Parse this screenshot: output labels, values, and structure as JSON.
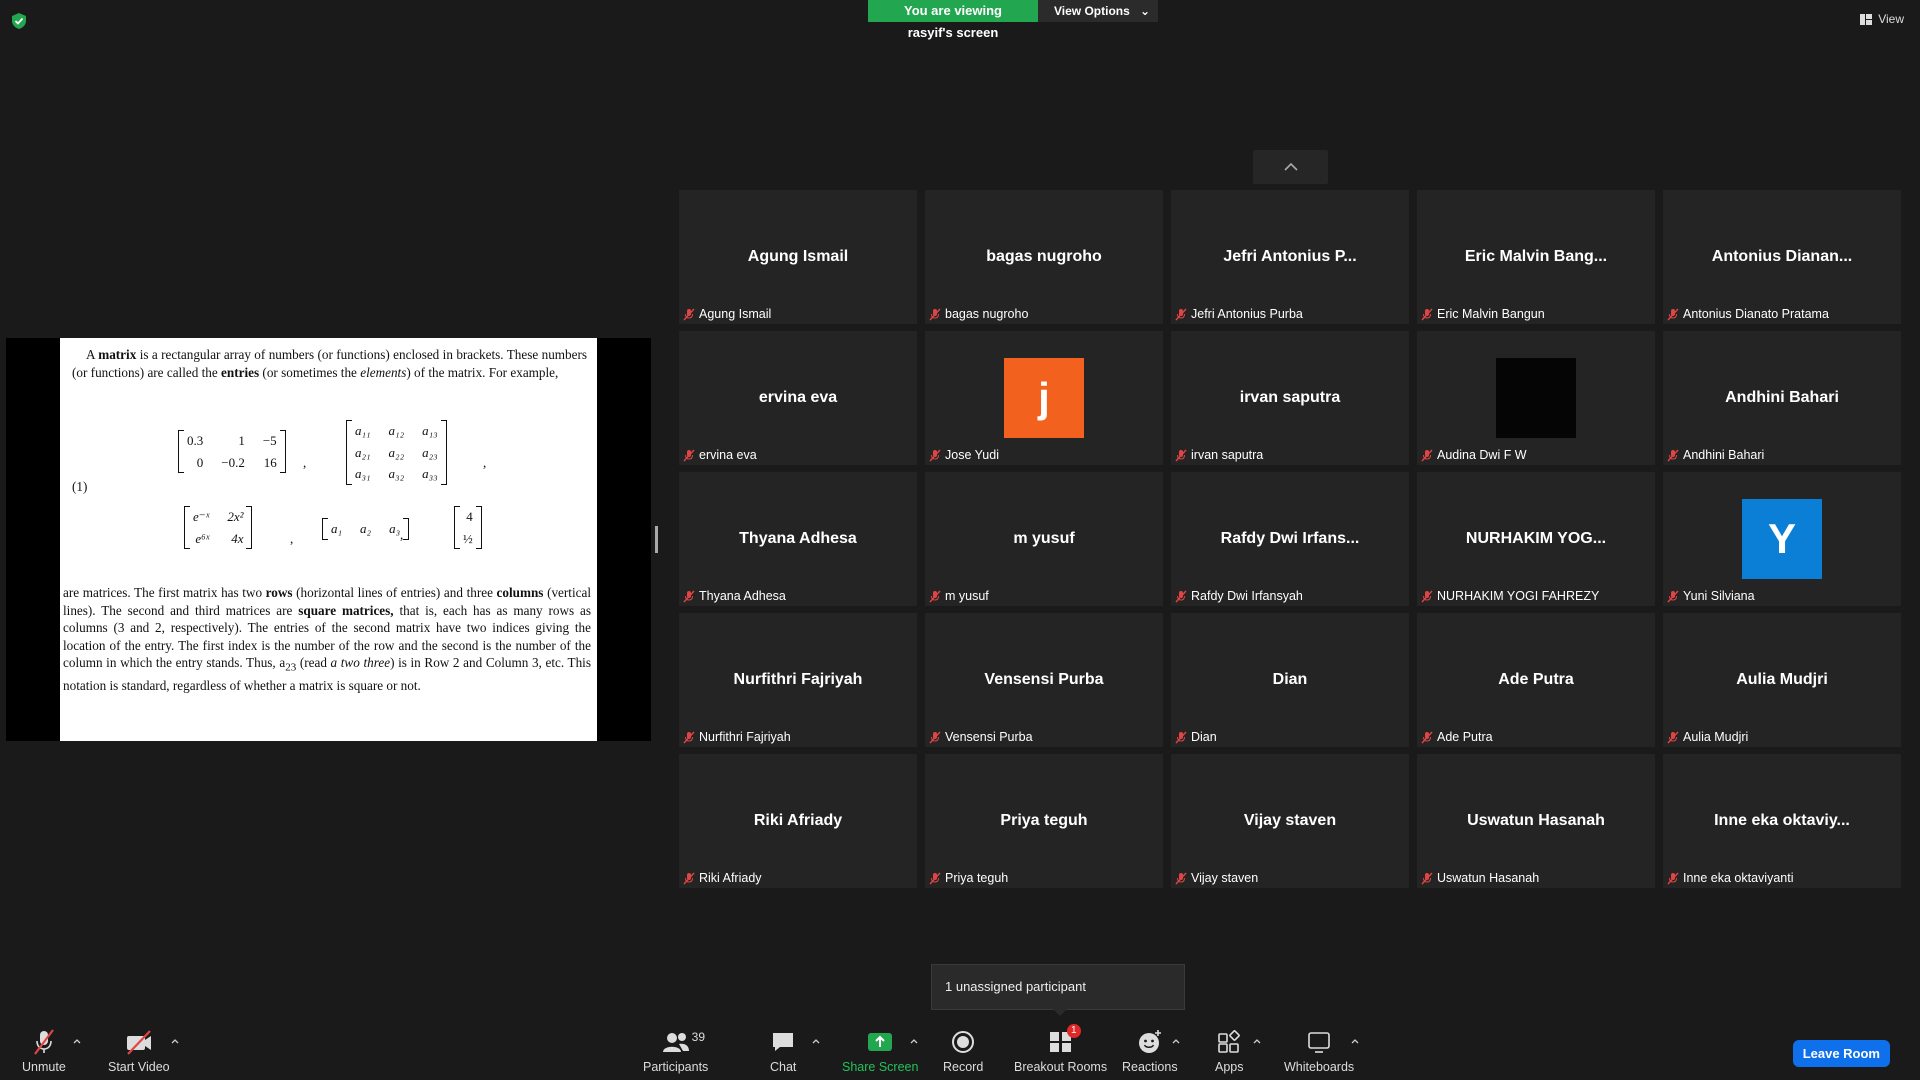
{
  "banner": {
    "viewing": "You are viewing rasyif's screen",
    "options": "View Options"
  },
  "view_label": "View",
  "document": {
    "para1_a": "A ",
    "para1_b": "matrix",
    "para1_c": " is a rectangular array of numbers (or functions) enclosed in brackets. These numbers (or functions) are called the ",
    "para1_d": "entries",
    "para1_e": " (or sometimes the ",
    "para1_f": "elements",
    "para1_g": ") of the matrix. For example,",
    "eq_number": "(1)",
    "para2_a": "are matrices. The first matrix has two ",
    "para2_b": "rows",
    "para2_c": " (horizontal lines of entries) and three ",
    "para2_d": "columns",
    "para2_e": " (vertical lines). The second and third matrices are ",
    "para2_f": "square matrices,",
    "para2_g": " that is, each has as many rows as columns (3 and 2, respectively). The entries of the second matrix have two indices giving the location of the entry. The first index is the number of the row and the second is the number of the column in which the entry stands. Thus, a",
    "para2_h": "23",
    "para2_i": " (read ",
    "para2_j": "a two three",
    "para2_k": ") is in Row 2 and Column 3, etc. This notation is standard, regardless of whether a matrix is square or not.",
    "m1": [
      [
        "0.3",
        "1",
        "−5"
      ],
      [
        "0",
        "−0.2",
        "16"
      ]
    ],
    "m2": [
      [
        "a₁₁",
        "a₁₂",
        "a₁₃"
      ],
      [
        "a₂₁",
        "a₂₂",
        "a₂₃"
      ],
      [
        "a₃₁",
        "a₃₂",
        "a₃₃"
      ]
    ],
    "m3": [
      [
        "e⁻ˣ",
        "2x²"
      ],
      [
        "e⁶ˣ",
        "4x"
      ]
    ],
    "m4": [
      "a₁",
      "a₂",
      "a₃"
    ],
    "m5": [
      "4",
      "½"
    ],
    "comma": ","
  },
  "participants": [
    {
      "big": "Agung Ismail",
      "label": "Agung Ismail"
    },
    {
      "big": "bagas nugroho",
      "label": "bagas nugroho"
    },
    {
      "big": "Jefri  Antonius  P...",
      "label": "Jefri Antonius Purba"
    },
    {
      "big": "Eric  Malvin  Bang...",
      "label": "Eric Malvin Bangun"
    },
    {
      "big": "Antonius  Dianan...",
      "label": "Antonius Dianato Pratama"
    },
    {
      "big": "ervina eva",
      "label": "ervina eva"
    },
    {
      "big": "j",
      "label": "Jose Yudi",
      "avatar": "orange"
    },
    {
      "big": "irvan saputra",
      "label": "irvan saputra"
    },
    {
      "big": "",
      "label": "Audina Dwi F W",
      "avatar": "black"
    },
    {
      "big": "Andhini Bahari",
      "label": "Andhini Bahari"
    },
    {
      "big": "Thyana Adhesa",
      "label": "Thyana Adhesa"
    },
    {
      "big": "m yusuf",
      "label": "m yusuf"
    },
    {
      "big": "Rafdy  Dwi  Irfans...",
      "label": "Rafdy Dwi Irfansyah"
    },
    {
      "big": "NURHAKIM  YOG...",
      "label": "NURHAKIM YOGI FAHREZY"
    },
    {
      "big": "Y",
      "label": "Yuni Silviana",
      "avatar": "blue"
    },
    {
      "big": "Nurfithri Fajriyah",
      "label": "Nurfithri Fajriyah"
    },
    {
      "big": "Vensensi Purba",
      "label": "Vensensi Purba"
    },
    {
      "big": "Dian",
      "label": "Dian"
    },
    {
      "big": "Ade Putra",
      "label": "Ade Putra"
    },
    {
      "big": "Aulia Mudjri",
      "label": "Aulia Mudjri"
    },
    {
      "big": "Riki Afriady",
      "label": "Riki Afriady"
    },
    {
      "big": "Priya teguh",
      "label": "Priya teguh"
    },
    {
      "big": "Vijay staven",
      "label": "Vijay staven"
    },
    {
      "big": "Uswatun Hasanah",
      "label": "Uswatun Hasanah"
    },
    {
      "big": "Inne  eka  oktaviy...",
      "label": "Inne eka oktaviyanti"
    }
  ],
  "colors": {
    "orange": "#f2611d",
    "blue": "#0b7fd6",
    "black": "#050505",
    "muted_red": "#e04545",
    "green": "#23a650"
  },
  "tooltip": "1 unassigned participant",
  "toolbar": {
    "unmute": "Unmute",
    "start_video": "Start Video",
    "participants": "Participants",
    "participants_count": "39",
    "chat": "Chat",
    "share": "Share Screen",
    "record": "Record",
    "breakout": "Breakout Rooms",
    "breakout_badge": "1",
    "reactions": "Reactions",
    "apps": "Apps",
    "whiteboards": "Whiteboards",
    "leave": "Leave Room"
  }
}
